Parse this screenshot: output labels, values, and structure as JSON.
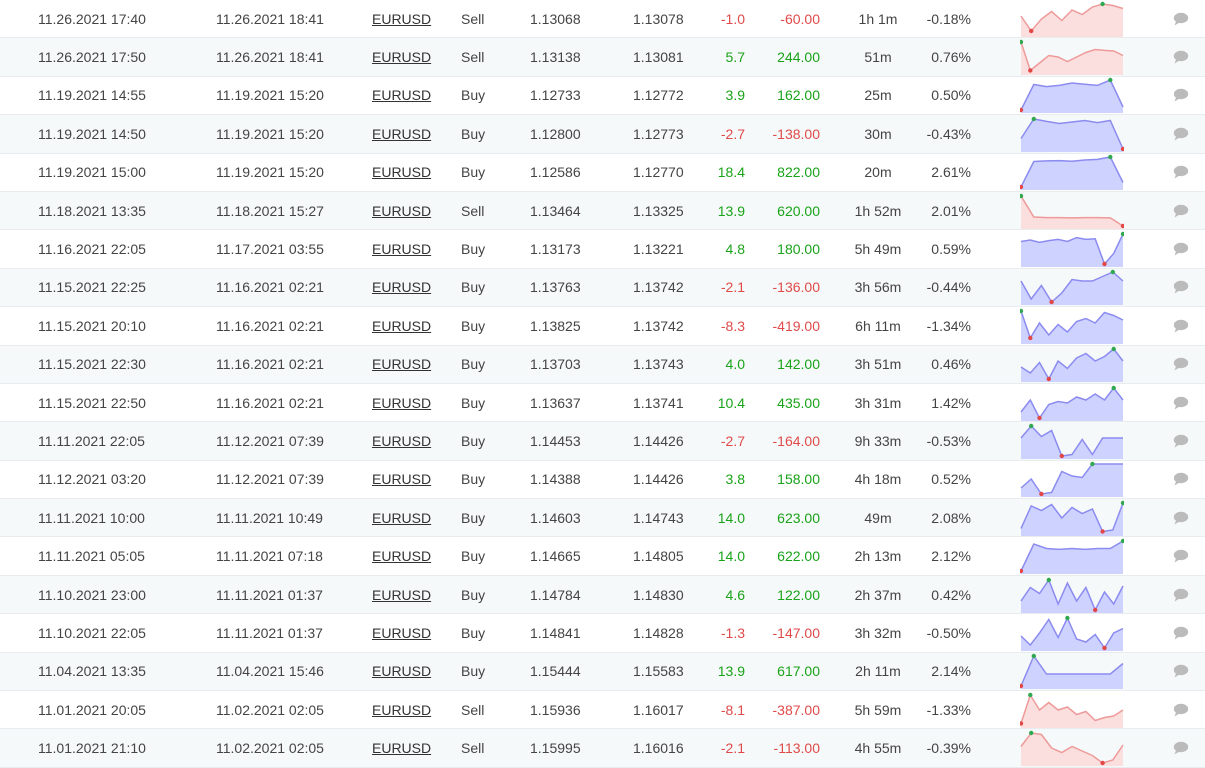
{
  "colors": {
    "positive_text": "#19a319",
    "negative_text": "#e04a4a",
    "buy_line": "#8b8bf0",
    "buy_fill": "#cdd2ff",
    "sell_line": "#ee9a9a",
    "sell_fill": "#fbdede",
    "max_dot": "#2fa84f",
    "min_dot": "#e34646",
    "comment_icon": "#bbbbbb"
  },
  "comment_icon": "speech-bubble-icon",
  "trades": [
    {
      "open": "11.26.2021 17:40",
      "close": "11.26.2021 18:41",
      "symbol": "EURUSD",
      "type": "Sell",
      "open_price": "1.13068",
      "close_price": "1.13078",
      "pips": "-1.0",
      "profit": "-60.00",
      "duration": "1h 1m",
      "gain": "-0.18%",
      "trend": [
        0.6,
        0.1,
        0.5,
        0.75,
        0.45,
        0.8,
        0.65,
        0.9,
        1.0,
        0.95,
        0.85
      ]
    },
    {
      "open": "11.26.2021 17:50",
      "close": "11.26.2021 18:41",
      "symbol": "EURUSD",
      "type": "Sell",
      "open_price": "1.13138",
      "close_price": "1.13081",
      "pips": "5.7",
      "profit": "244.00",
      "duration": "51m",
      "gain": "0.76%",
      "trend": [
        1.0,
        0.05,
        0.3,
        0.55,
        0.5,
        0.35,
        0.5,
        0.65,
        0.75,
        0.72,
        0.7,
        0.55
      ]
    },
    {
      "open": "11.19.2021 14:55",
      "close": "11.19.2021 15:20",
      "symbol": "EURUSD",
      "type": "Buy",
      "open_price": "1.12733",
      "close_price": "1.12772",
      "pips": "3.9",
      "profit": "162.00",
      "duration": "25m",
      "gain": "0.50%",
      "trend": [
        0.0,
        0.85,
        0.78,
        0.82,
        0.9,
        0.86,
        0.82,
        1.0,
        0.1
      ]
    },
    {
      "open": "11.19.2021 14:50",
      "close": "11.19.2021 15:20",
      "symbol": "EURUSD",
      "type": "Buy",
      "open_price": "1.12800",
      "close_price": "1.12773",
      "pips": "-2.7",
      "profit": "-138.00",
      "duration": "30m",
      "gain": "-0.43%",
      "trend": [
        0.35,
        1.0,
        0.92,
        0.85,
        0.9,
        0.95,
        0.88,
        0.95,
        0.0
      ]
    },
    {
      "open": "11.19.2021 15:00",
      "close": "11.19.2021 15:20",
      "symbol": "EURUSD",
      "type": "Buy",
      "open_price": "1.12586",
      "close_price": "1.12770",
      "pips": "18.4",
      "profit": "822.00",
      "duration": "20m",
      "gain": "2.61%",
      "trend": [
        0.0,
        0.85,
        0.87,
        0.88,
        0.86,
        0.9,
        0.92,
        1.0,
        0.15
      ]
    },
    {
      "open": "11.18.2021 13:35",
      "close": "11.18.2021 15:27",
      "symbol": "EURUSD",
      "type": "Sell",
      "open_price": "1.13464",
      "close_price": "1.13325",
      "pips": "13.9",
      "profit": "620.00",
      "duration": "1h 52m",
      "gain": "2.01%",
      "trend": [
        1.0,
        0.3,
        0.28,
        0.28,
        0.27,
        0.28,
        0.28,
        0.27,
        0.0
      ]
    },
    {
      "open": "11.16.2021 22:05",
      "close": "11.17.2021 03:55",
      "symbol": "EURUSD",
      "type": "Buy",
      "open_price": "1.13173",
      "close_price": "1.13221",
      "pips": "4.8",
      "profit": "180.00",
      "duration": "5h 49m",
      "gain": "0.59%",
      "trend": [
        0.75,
        0.8,
        0.72,
        0.78,
        0.82,
        0.75,
        0.88,
        0.82,
        0.84,
        0.0,
        0.35,
        1.0
      ]
    },
    {
      "open": "11.15.2021 22:25",
      "close": "11.16.2021 02:21",
      "symbol": "EURUSD",
      "type": "Buy",
      "open_price": "1.13763",
      "close_price": "1.13742",
      "pips": "-2.1",
      "profit": "-136.00",
      "duration": "3h 56m",
      "gain": "-0.44%",
      "trend": [
        0.7,
        0.1,
        0.55,
        0.0,
        0.3,
        0.75,
        0.7,
        0.7,
        0.85,
        1.0,
        0.7
      ]
    },
    {
      "open": "11.15.2021 20:10",
      "close": "11.16.2021 02:21",
      "symbol": "EURUSD",
      "type": "Buy",
      "open_price": "1.13825",
      "close_price": "1.13742",
      "pips": "-8.3",
      "profit": "-419.00",
      "duration": "6h 11m",
      "gain": "-1.34%",
      "trend": [
        1.0,
        0.1,
        0.6,
        0.2,
        0.55,
        0.3,
        0.65,
        0.75,
        0.6,
        0.95,
        0.85,
        0.7
      ]
    },
    {
      "open": "11.15.2021 22:30",
      "close": "11.16.2021 02:21",
      "symbol": "EURUSD",
      "type": "Buy",
      "open_price": "1.13703",
      "close_price": "1.13743",
      "pips": "4.0",
      "profit": "142.00",
      "duration": "3h 51m",
      "gain": "0.46%",
      "trend": [
        0.4,
        0.2,
        0.55,
        0.0,
        0.6,
        0.35,
        0.7,
        0.85,
        0.6,
        0.75,
        1.0,
        0.6
      ]
    },
    {
      "open": "11.15.2021 22:50",
      "close": "11.16.2021 02:21",
      "symbol": "EURUSD",
      "type": "Buy",
      "open_price": "1.13637",
      "close_price": "1.13741",
      "pips": "10.4",
      "profit": "435.00",
      "duration": "3h 31m",
      "gain": "1.42%",
      "trend": [
        0.2,
        0.6,
        0.0,
        0.45,
        0.55,
        0.5,
        0.7,
        0.6,
        0.8,
        0.6,
        1.0,
        0.6
      ]
    },
    {
      "open": "11.11.2021 22:05",
      "close": "11.12.2021 07:39",
      "symbol": "EURUSD",
      "type": "Buy",
      "open_price": "1.14453",
      "close_price": "1.14426",
      "pips": "-2.7",
      "profit": "-164.00",
      "duration": "9h 33m",
      "gain": "-0.53%",
      "trend": [
        0.6,
        1.0,
        0.65,
        0.85,
        0.0,
        0.05,
        0.55,
        0.05,
        0.6,
        0.6,
        0.6
      ]
    },
    {
      "open": "11.12.2021 03:20",
      "close": "11.12.2021 07:39",
      "symbol": "EURUSD",
      "type": "Buy",
      "open_price": "1.14388",
      "close_price": "1.14426",
      "pips": "3.8",
      "profit": "158.00",
      "duration": "4h 18m",
      "gain": "0.52%",
      "trend": [
        0.2,
        0.5,
        0.0,
        0.05,
        0.75,
        0.6,
        0.55,
        1.0,
        1.0,
        1.0,
        1.0
      ]
    },
    {
      "open": "11.11.2021 10:00",
      "close": "11.11.2021 10:49",
      "symbol": "EURUSD",
      "type": "Buy",
      "open_price": "1.14603",
      "close_price": "1.14743",
      "pips": "14.0",
      "profit": "623.00",
      "duration": "49m",
      "gain": "2.08%",
      "trend": [
        0.15,
        0.9,
        0.75,
        0.95,
        0.5,
        0.85,
        0.65,
        0.8,
        0.05,
        0.1,
        1.0
      ]
    },
    {
      "open": "11.11.2021 05:05",
      "close": "11.11.2021 07:18",
      "symbol": "EURUSD",
      "type": "Buy",
      "open_price": "1.14665",
      "close_price": "1.14805",
      "pips": "14.0",
      "profit": "622.00",
      "duration": "2h 13m",
      "gain": "2.12%",
      "trend": [
        0.0,
        0.9,
        0.75,
        0.72,
        0.75,
        0.72,
        0.75,
        0.75,
        1.0
      ]
    },
    {
      "open": "11.10.2021 23:00",
      "close": "11.11.2021 01:37",
      "symbol": "EURUSD",
      "type": "Buy",
      "open_price": "1.14784",
      "close_price": "1.14830",
      "pips": "4.6",
      "profit": "122.00",
      "duration": "2h 37m",
      "gain": "0.42%",
      "trend": [
        0.3,
        0.75,
        0.55,
        1.0,
        0.2,
        0.9,
        0.3,
        0.75,
        0.0,
        0.6,
        0.2,
        0.8
      ]
    },
    {
      "open": "11.10.2021 22:05",
      "close": "11.11.2021 01:37",
      "symbol": "EURUSD",
      "type": "Buy",
      "open_price": "1.14841",
      "close_price": "1.14828",
      "pips": "-1.3",
      "profit": "-147.00",
      "duration": "3h 32m",
      "gain": "-0.50%",
      "trend": [
        0.4,
        0.1,
        0.5,
        0.95,
        0.35,
        1.0,
        0.3,
        0.2,
        0.45,
        0.0,
        0.5,
        0.65
      ]
    },
    {
      "open": "11.04.2021 13:35",
      "close": "11.04.2021 15:46",
      "symbol": "EURUSD",
      "type": "Buy",
      "open_price": "1.15444",
      "close_price": "1.15583",
      "pips": "13.9",
      "profit": "617.00",
      "duration": "2h 11m",
      "gain": "2.14%",
      "trend": [
        0.0,
        1.0,
        0.4,
        0.4,
        0.4,
        0.4,
        0.4,
        0.4,
        0.75
      ]
    },
    {
      "open": "11.01.2021 20:05",
      "close": "11.02.2021 02:05",
      "symbol": "EURUSD",
      "type": "Sell",
      "open_price": "1.15936",
      "close_price": "1.16017",
      "pips": "-8.1",
      "profit": "-387.00",
      "duration": "5h 59m",
      "gain": "-1.33%",
      "trend": [
        0.05,
        1.0,
        0.5,
        0.75,
        0.5,
        0.6,
        0.35,
        0.45,
        0.15,
        0.25,
        0.3,
        0.5
      ]
    },
    {
      "open": "11.01.2021 21:10",
      "close": "11.02.2021 02:05",
      "symbol": "EURUSD",
      "type": "Sell",
      "open_price": "1.15995",
      "close_price": "1.16016",
      "pips": "-2.1",
      "profit": "-113.00",
      "duration": "4h 55m",
      "gain": "-0.39%",
      "trend": [
        0.55,
        1.0,
        0.95,
        0.5,
        0.35,
        0.55,
        0.4,
        0.25,
        0.0,
        0.1,
        0.6
      ]
    }
  ]
}
